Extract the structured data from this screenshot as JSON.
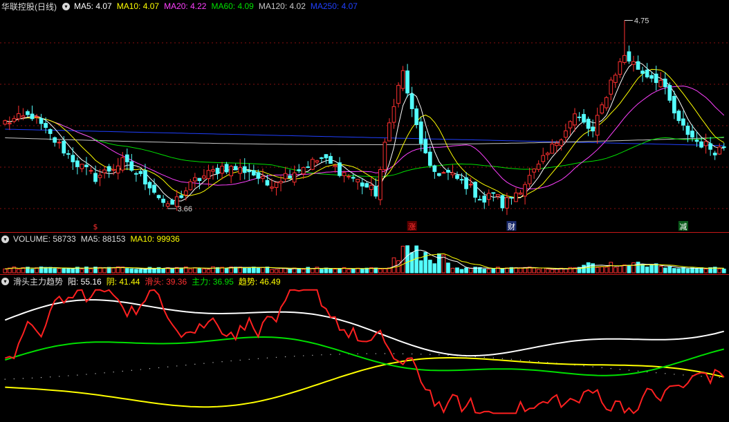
{
  "colors": {
    "up": "#ff3030",
    "down": "#54ffff",
    "ma5": "#ffffff",
    "ma10": "#ffff00",
    "ma20": "#ff40ff",
    "ma60": "#00e000",
    "ma120": "#c8c8c8",
    "ma250": "#2040ff",
    "grid": "#8a1010"
  },
  "price_panel": {
    "title": "华联控股(日线)",
    "legend": [
      {
        "label": "MA5: 4.07",
        "color": "#ffffff"
      },
      {
        "label": "MA10: 4.07",
        "color": "#ffff00"
      },
      {
        "label": "MA20: 4.22",
        "color": "#ff40ff"
      },
      {
        "label": "MA60: 4.09",
        "color": "#00e000"
      },
      {
        "label": "MA120: 4.02",
        "color": "#c8c8c8"
      },
      {
        "label": "MA250: 4.07",
        "color": "#2040ff"
      }
    ],
    "high_label": "4.75",
    "low_label": "3.66",
    "markers": [
      {
        "text": "$",
        "color": "#ff3030",
        "box": false
      },
      {
        "text": "涨",
        "color": "#ff3030",
        "box": true,
        "bg": "#5a0000"
      },
      {
        "text": "财",
        "color": "#ffffff",
        "box": true,
        "bg": "#1a2a6a"
      },
      {
        "text": "减",
        "color": "#ffffff",
        "box": true,
        "bg": "#0a5a1a"
      }
    ]
  },
  "volume_panel": {
    "legend": [
      {
        "label": "VOLUME: 58733",
        "color": "#dddddd"
      },
      {
        "label": "MA5: 88153",
        "color": "#dddddd"
      },
      {
        "label": "MA10: 99936",
        "color": "#ffff00"
      }
    ]
  },
  "indicator_panel": {
    "legend": [
      {
        "label": "滑头主力趋势",
        "color": "#dddddd"
      },
      {
        "label": "阳: 55.16",
        "color": "#ffffff"
      },
      {
        "label": "阴: 41.44",
        "color": "#ffff00"
      },
      {
        "label": "滑头: 39.36",
        "color": "#ff3030"
      },
      {
        "label": "主力: 36.95",
        "color": "#00e000"
      },
      {
        "label": "趋势: 46.49",
        "color": "#ffff00"
      }
    ]
  },
  "chart_data": {
    "type": "candlestick",
    "count": 160,
    "key_points": [
      [
        0,
        4.16
      ],
      [
        6,
        4.2
      ],
      [
        10,
        4.08
      ],
      [
        16,
        3.92
      ],
      [
        20,
        3.84
      ],
      [
        26,
        3.93
      ],
      [
        32,
        3.8
      ],
      [
        36,
        3.66
      ],
      [
        42,
        3.82
      ],
      [
        48,
        3.9
      ],
      [
        54,
        3.88
      ],
      [
        58,
        3.8
      ],
      [
        64,
        3.88
      ],
      [
        70,
        3.95
      ],
      [
        74,
        3.88
      ],
      [
        78,
        3.82
      ],
      [
        82,
        3.75
      ],
      [
        84,
        4.02
      ],
      [
        86,
        4.28
      ],
      [
        88,
        4.45
      ],
      [
        90,
        4.22
      ],
      [
        94,
        3.88
      ],
      [
        98,
        3.86
      ],
      [
        102,
        3.8
      ],
      [
        106,
        3.7
      ],
      [
        108,
        3.76
      ],
      [
        110,
        3.68
      ],
      [
        114,
        3.78
      ],
      [
        118,
        3.9
      ],
      [
        122,
        4.05
      ],
      [
        126,
        4.2
      ],
      [
        130,
        4.1
      ],
      [
        134,
        4.4
      ],
      [
        137,
        4.55
      ],
      [
        141,
        4.45
      ],
      [
        145,
        4.4
      ],
      [
        149,
        4.15
      ],
      [
        153,
        4.05
      ],
      [
        157,
        4.0
      ],
      [
        159,
        4.02
      ]
    ],
    "price_high": 4.75,
    "price_low": 3.66,
    "volume_ma5": 88153,
    "volume_ma10": 99936,
    "indicator_values": {
      "yang": 55.16,
      "yin": 41.44,
      "huatou": 39.36,
      "zhuli": 36.95,
      "qushi": 46.49
    }
  }
}
